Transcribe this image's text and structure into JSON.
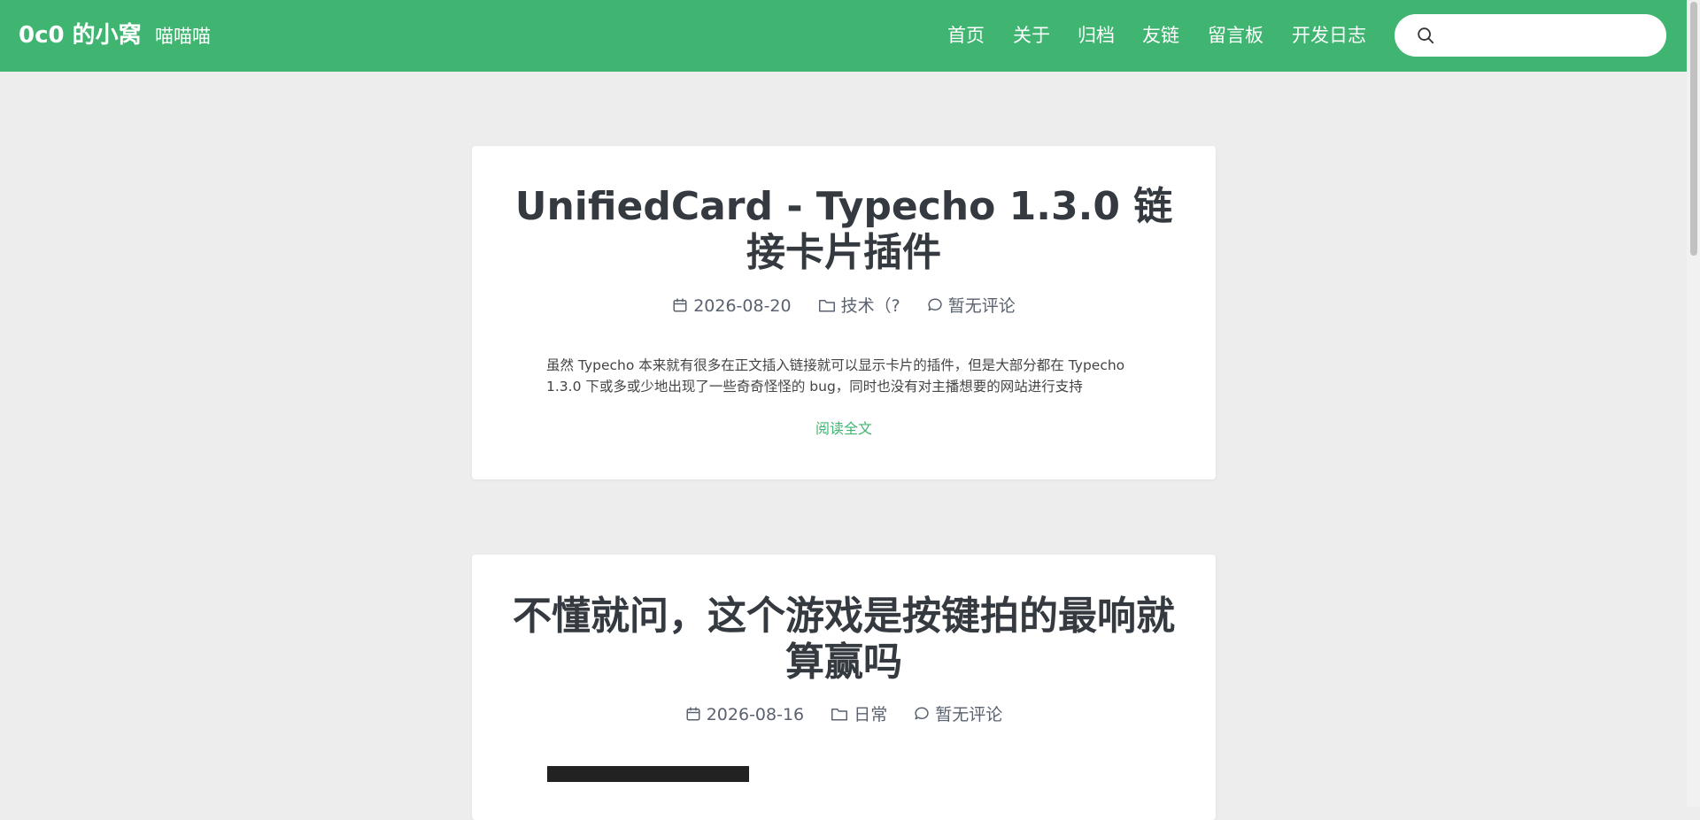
{
  "header": {
    "site_title": "0c0 的小窝",
    "subtitle": "喵喵喵",
    "nav": [
      "首页",
      "关于",
      "归档",
      "友链",
      "留言板",
      "开发日志"
    ],
    "search_placeholder": ""
  },
  "posts": [
    {
      "title": "UnifiedCard - Typecho 1.3.0 链接卡片插件",
      "date": "2026-08-20",
      "category": "技术（?",
      "comments": "暂无评论",
      "excerpt": "虽然 Typecho 本来就有很多在正文插入链接就可以显示卡片的插件，但是大部分都在 Typecho 1.3.0 下或多或少地出现了一些奇奇怪怪的 bug，同时也没有对主播想要的网站进行支持",
      "read_more": "阅读全文"
    },
    {
      "title": "不懂就问，这个游戏是按键拍的最响就算赢吗",
      "date": "2026-08-16",
      "category": "日常",
      "comments": "暂无评论"
    }
  ],
  "colors": {
    "accent": "#3fb571",
    "background": "#ededed"
  },
  "icons": [
    "search-icon",
    "calendar-icon",
    "folder-icon",
    "comment-icon"
  ]
}
